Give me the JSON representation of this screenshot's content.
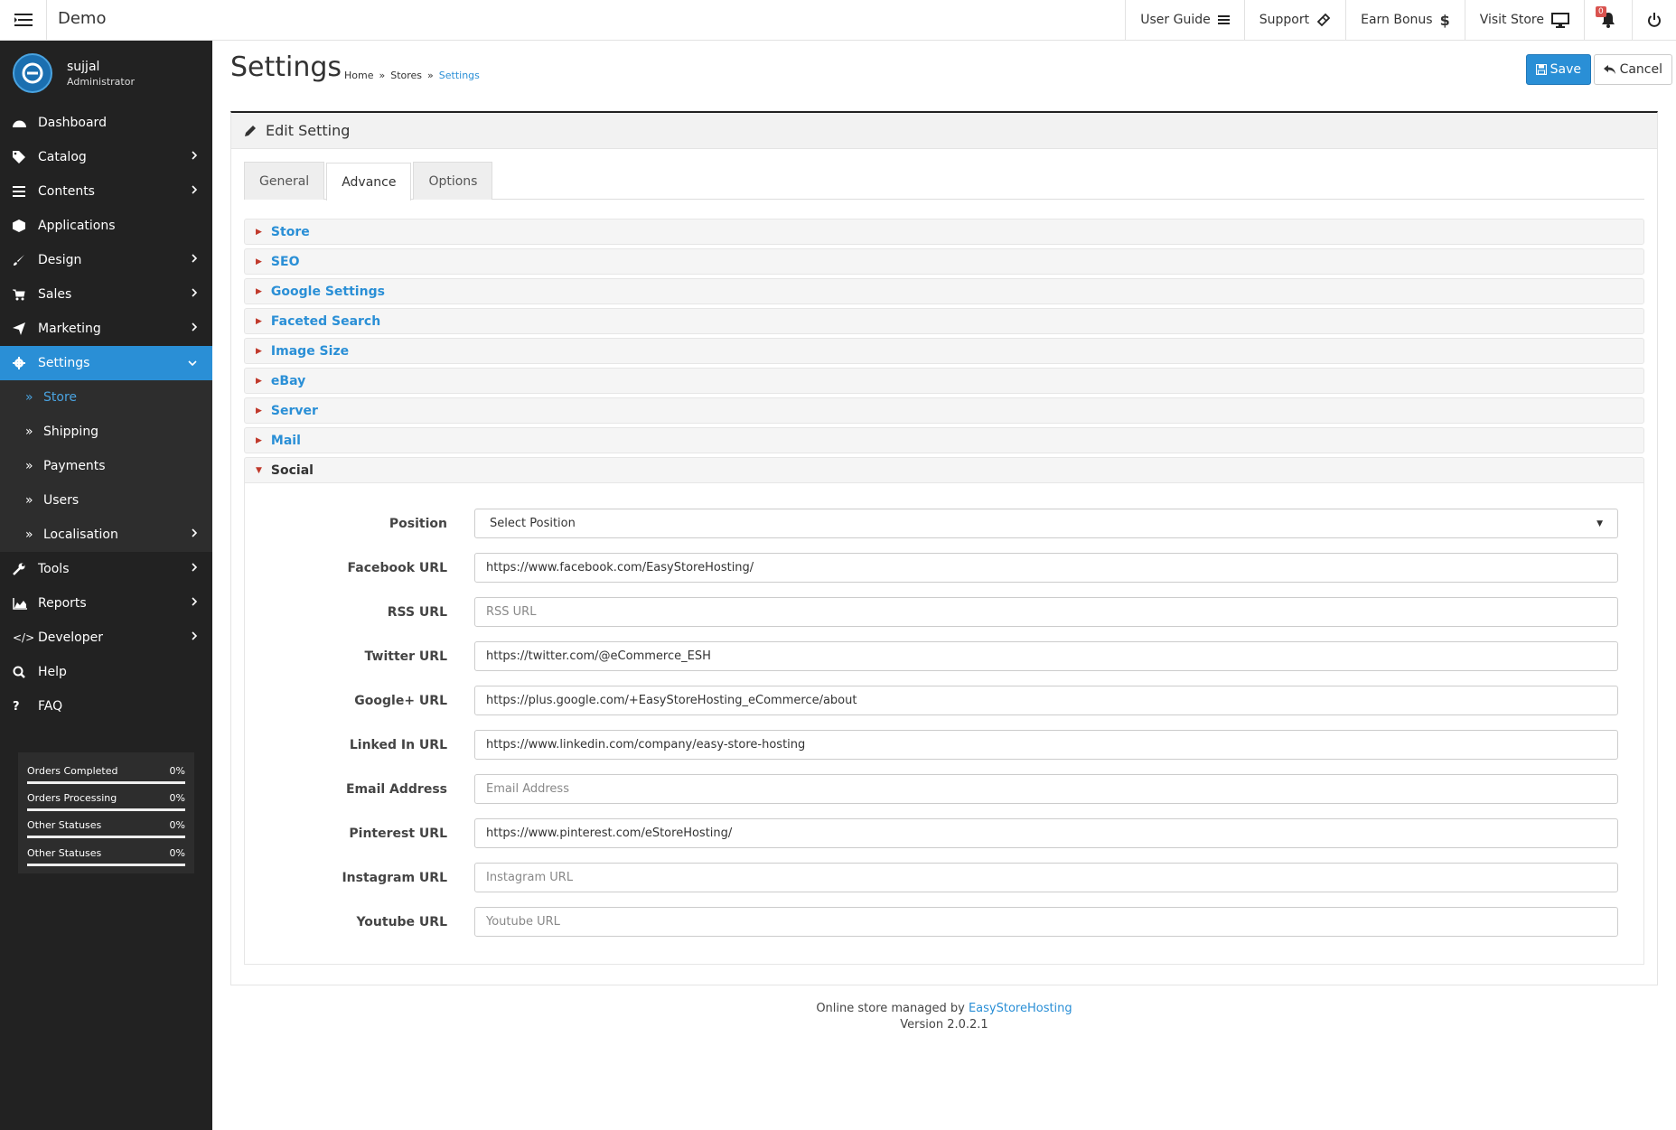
{
  "app": {
    "title": "Demo"
  },
  "topnav": {
    "user_guide": "User Guide",
    "support": "Support",
    "earn_bonus": "Earn Bonus",
    "visit_store": "Visit Store",
    "notifications_count": "0"
  },
  "user": {
    "name": "sujjal",
    "role": "Administrator"
  },
  "sidebar": {
    "dashboard": "Dashboard",
    "catalog": "Catalog",
    "contents": "Contents",
    "applications": "Applications",
    "design": "Design",
    "sales": "Sales",
    "marketing": "Marketing",
    "settings": "Settings",
    "store": "Store",
    "shipping": "Shipping",
    "payments": "Payments",
    "users": "Users",
    "localisation": "Localisation",
    "tools": "Tools",
    "reports": "Reports",
    "developer": "Developer",
    "help": "Help",
    "faq": "FAQ"
  },
  "stats": [
    {
      "label": "Orders Completed",
      "value": "0%"
    },
    {
      "label": "Orders Processing",
      "value": "0%"
    },
    {
      "label": "Other Statuses",
      "value": "0%"
    }
  ],
  "stats_overflow": {
    "label": "Other Statuses",
    "value": "0%"
  },
  "page": {
    "title": "Settings",
    "breadcrumb": [
      "Home",
      "Stores",
      "Settings"
    ],
    "save": "Save",
    "cancel": "Cancel"
  },
  "panel": {
    "heading": "Edit Setting"
  },
  "tabs": [
    "General",
    "Advance",
    "Options"
  ],
  "accordion": [
    "Store",
    "SEO",
    "Google Settings",
    "Faceted Search",
    "Image Size",
    "eBay",
    "Server",
    "Mail",
    "Social"
  ],
  "social": {
    "position_label": "Position",
    "position_value": "Select Position",
    "facebook_label": "Facebook URL",
    "facebook_value": "https://www.facebook.com/EasyStoreHosting/",
    "rss_label": "RSS URL",
    "rss_placeholder": "RSS URL",
    "twitter_label": "Twitter URL",
    "twitter_value": "https://twitter.com/@eCommerce_ESH",
    "google_label": "Google+ URL",
    "google_value": "https://plus.google.com/+EasyStoreHosting_eCommerce/about",
    "linkedin_label": "Linked In URL",
    "linkedin_value": "https://www.linkedin.com/company/easy-store-hosting",
    "email_label": "Email Address",
    "email_placeholder": "Email Address",
    "pinterest_label": "Pinterest URL",
    "pinterest_value": "https://www.pinterest.com/eStoreHosting/",
    "instagram_label": "Instagram URL",
    "instagram_placeholder": "Instagram URL",
    "youtube_label": "Youtube URL",
    "youtube_placeholder": "Youtube URL"
  },
  "footer": {
    "text": "Online store managed by",
    "link": "EasyStoreHosting",
    "version": "Version 2.0.2.1"
  },
  "colors": {
    "accent": "#2a8fd6",
    "sidebar_bg": "#222222",
    "caret": "#c0392b"
  }
}
